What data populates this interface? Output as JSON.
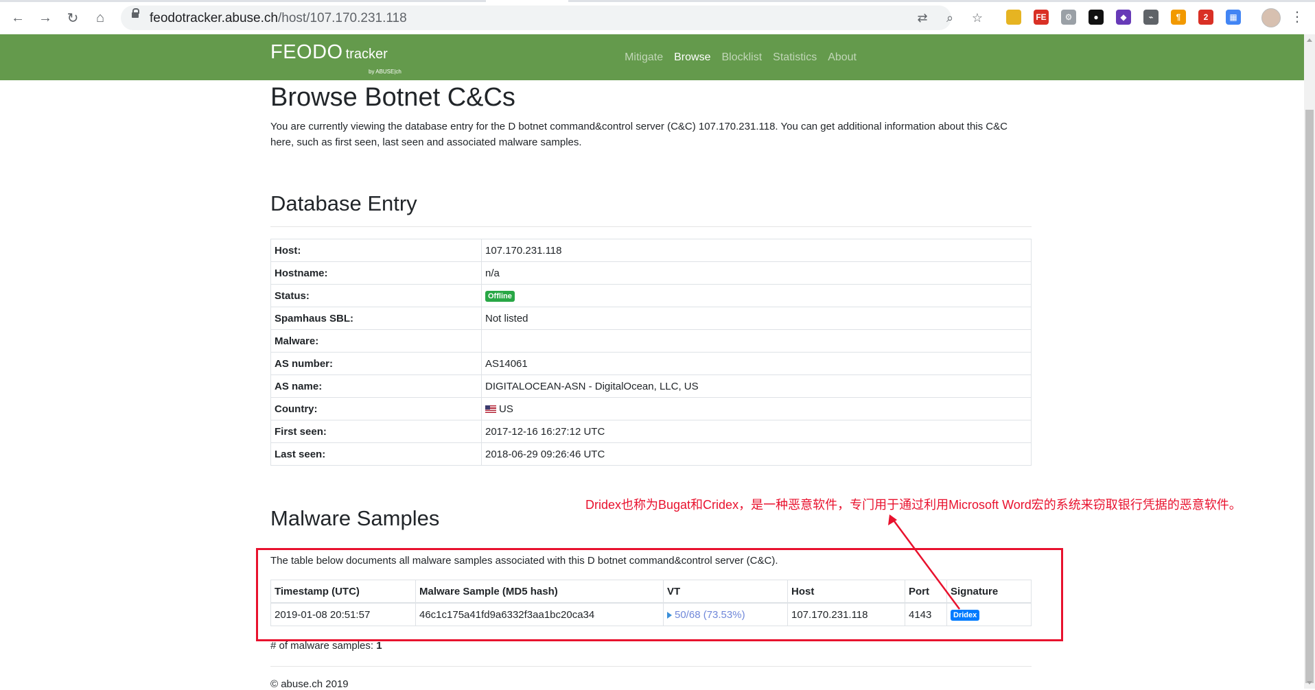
{
  "browser": {
    "url_host": "feodotracker.abuse.ch",
    "url_path": "/host/107.170.231.118",
    "extensions": [
      {
        "name": "ext-icon-1",
        "text": "",
        "color": "#e6b422"
      },
      {
        "name": "ext-icon-fe",
        "text": "FE",
        "color": "#d93025"
      },
      {
        "name": "ext-icon-gear",
        "text": "⚙",
        "color": "#9aa0a6"
      },
      {
        "name": "ext-icon-circle",
        "text": "●",
        "color": "#111111"
      },
      {
        "name": "ext-icon-cube",
        "text": "◆",
        "color": "#673ab7"
      },
      {
        "name": "ext-icon-chart",
        "text": "⌁",
        "color": "#5f6368"
      },
      {
        "name": "ext-icon-pilcrow",
        "text": "¶",
        "color": "#f29900"
      },
      {
        "name": "ext-icon-badge",
        "text": "2",
        "color": "#d93025"
      },
      {
        "name": "ext-icon-grid",
        "text": "▦",
        "color": "#4285f4"
      }
    ]
  },
  "navbar": {
    "brand_main": "FEODO",
    "brand_sub": "tracker",
    "brand_by": "by ABUSE|ch",
    "links": [
      "Mitigate",
      "Browse",
      "Blocklist",
      "Statistics",
      "About"
    ],
    "active": "Browse",
    "color": "#649a4c"
  },
  "page": {
    "title": "Browse Botnet C&Cs",
    "intro": "You are currently viewing the database entry for the D botnet command&control server (C&C) 107.170.231.118. You can get additional information about this C&C here, such as first seen, last seen and associated malware samples.",
    "db_heading": "Database Entry",
    "db_rows": [
      {
        "key": "Host:",
        "value": "107.170.231.118"
      },
      {
        "key": "Hostname:",
        "value": "n/a"
      },
      {
        "key": "Status:",
        "value": "Offline"
      },
      {
        "key": "Spamhaus SBL:",
        "value": "Not listed"
      },
      {
        "key": "Malware:",
        "value": ""
      },
      {
        "key": "AS number:",
        "value": "AS14061"
      },
      {
        "key": "AS name:",
        "value": "DIGITALOCEAN-ASN - DigitalOcean, LLC, US"
      },
      {
        "key": "Country:",
        "value": "US"
      },
      {
        "key": "First seen:",
        "value": "2017-12-16 16:27:12 UTC"
      },
      {
        "key": "Last seen:",
        "value": "2018-06-29 09:26:46 UTC"
      }
    ],
    "samples_heading": "Malware Samples",
    "samples_intro": "The table below documents all malware samples associated with this D botnet command&control server (C&C).",
    "samples_columns": [
      "Timestamp (UTC)",
      "Malware Sample (MD5 hash)",
      "VT",
      "Host",
      "Port",
      "Signature"
    ],
    "samples_rows": [
      {
        "timestamp": "2019-01-08 20:51:57",
        "md5": "46c1c175a41fd9a6332f3aa1bc20ca34",
        "vt": "50/68 (73.53%)",
        "host": "107.170.231.118",
        "port": "4143",
        "signature": "Dridex"
      }
    ],
    "count_label": "# of malware samples:",
    "count_value": "1",
    "footer": "© abuse.ch 2019"
  },
  "annotation": {
    "text": "Dridex也称为Bugat和Cridex，是一种恶意软件，专门用于通过利用Microsoft Word宏的系统来窃取银行凭据的恶意软件。",
    "color": "#e8112d"
  }
}
